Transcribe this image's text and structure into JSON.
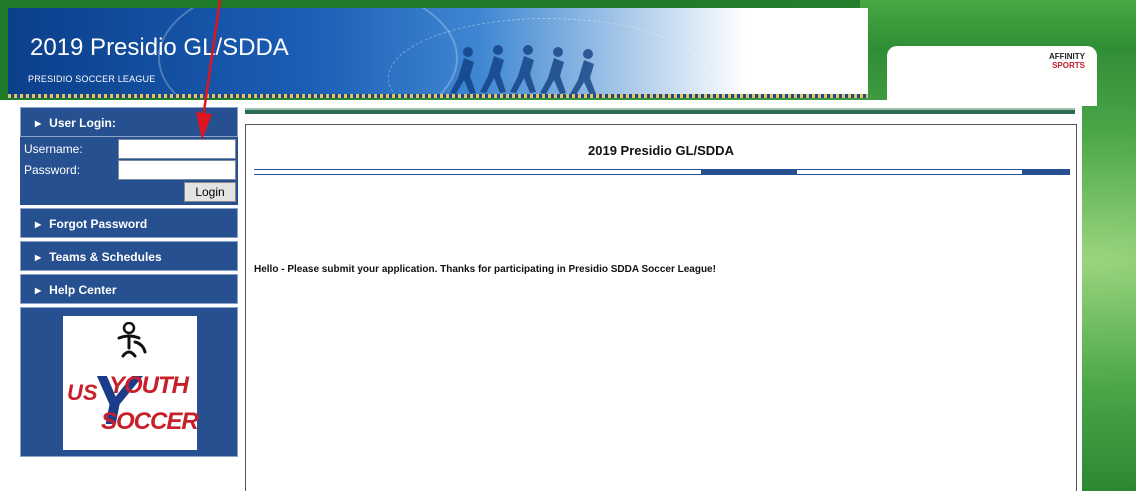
{
  "header": {
    "title": "2019 Presidio GL/SDDA",
    "subtitle": "PRESIDIO SOCCER LEAGUE",
    "brand_line1": "AFFINITY",
    "brand_line2": "SPORTS"
  },
  "sidebar": {
    "login_heading": "User Login:",
    "username_label": "Username:",
    "password_label": "Password:",
    "username_value": "",
    "password_value": "",
    "login_button": "Login",
    "items": [
      {
        "label": "Forgot Password"
      },
      {
        "label": "Teams & Schedules"
      },
      {
        "label": "Help Center"
      }
    ],
    "logo": {
      "us": "US",
      "youth": "YOUTH",
      "soccer": "SOCCER",
      "y": "Y"
    }
  },
  "main": {
    "title": "2019 Presidio GL/SDDA",
    "message": "Hello - Please submit your application.  Thanks for participating in Presidio SDDA Soccer League!"
  },
  "colors": {
    "sidebar_bg": "#26508f",
    "accent_red": "#e0141e",
    "content_bar": "#2c6b52"
  }
}
